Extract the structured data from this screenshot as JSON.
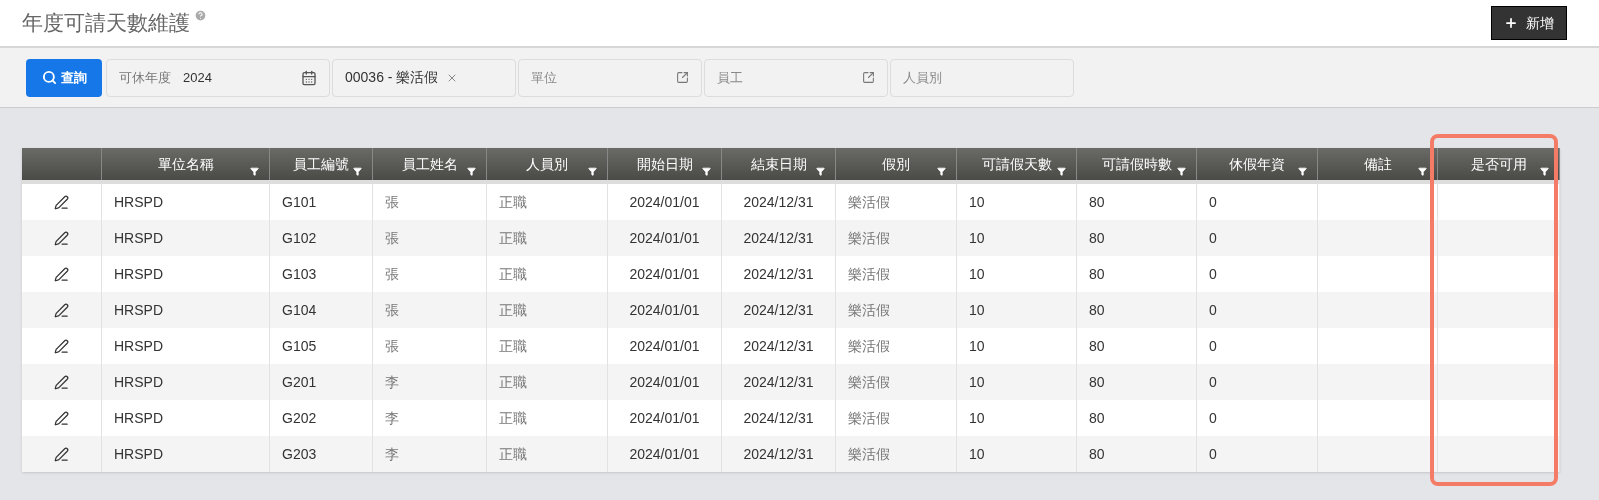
{
  "page": {
    "title": "年度可請天數維護",
    "add_button": "新增"
  },
  "toolbar": {
    "search_button": "查詢",
    "filters": [
      {
        "kind": "date",
        "label": "可休年度",
        "value": "2024"
      },
      {
        "kind": "tag",
        "value": "00036 - 樂活假"
      },
      {
        "kind": "picker",
        "placeholder": "單位"
      },
      {
        "kind": "picker",
        "placeholder": "員工"
      },
      {
        "kind": "text",
        "placeholder": "人員別"
      }
    ]
  },
  "table": {
    "columns": [
      {
        "label": "單位名稱",
        "highlighted": false
      },
      {
        "label": "員工編號",
        "highlighted": false
      },
      {
        "label": "員工姓名",
        "highlighted": false
      },
      {
        "label": "人員別",
        "highlighted": false
      },
      {
        "label": "開始日期",
        "highlighted": false
      },
      {
        "label": "結束日期",
        "highlighted": false
      },
      {
        "label": "假別",
        "highlighted": false
      },
      {
        "label": "可請假天數",
        "highlighted": false
      },
      {
        "label": "可請假時數",
        "highlighted": false
      },
      {
        "label": "休假年資",
        "highlighted": false
      },
      {
        "label": "備註",
        "highlighted": false
      },
      {
        "label": "是否可用",
        "highlighted": true
      }
    ],
    "rows": [
      [
        "HRSPD",
        "G101",
        "張",
        "正職",
        "2024/01/01",
        "2024/12/31",
        "樂活假",
        "10",
        "80",
        "0",
        "",
        ""
      ],
      [
        "HRSPD",
        "G102",
        "張",
        "正職",
        "2024/01/01",
        "2024/12/31",
        "樂活假",
        "10",
        "80",
        "0",
        "",
        ""
      ],
      [
        "HRSPD",
        "G103",
        "張",
        "正職",
        "2024/01/01",
        "2024/12/31",
        "樂活假",
        "10",
        "80",
        "0",
        "",
        ""
      ],
      [
        "HRSPD",
        "G104",
        "張",
        "正職",
        "2024/01/01",
        "2024/12/31",
        "樂活假",
        "10",
        "80",
        "0",
        "",
        ""
      ],
      [
        "HRSPD",
        "G105",
        "張",
        "正職",
        "2024/01/01",
        "2024/12/31",
        "樂活假",
        "10",
        "80",
        "0",
        "",
        ""
      ],
      [
        "HRSPD",
        "G201",
        "李",
        "正職",
        "2024/01/01",
        "2024/12/31",
        "樂活假",
        "10",
        "80",
        "0",
        "",
        ""
      ],
      [
        "HRSPD",
        "G202",
        "李",
        "正職",
        "2024/01/01",
        "2024/12/31",
        "樂活假",
        "10",
        "80",
        "0",
        "",
        ""
      ],
      [
        "HRSPD",
        "G203",
        "李",
        "正職",
        "2024/01/01",
        "2024/12/31",
        "樂活假",
        "10",
        "80",
        "0",
        "",
        ""
      ]
    ]
  }
}
